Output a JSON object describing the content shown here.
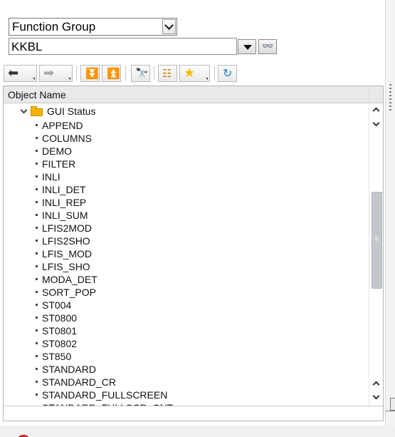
{
  "object_type": {
    "selected": "Function Group"
  },
  "object_name": {
    "value": "KKBL"
  },
  "toolbar": {
    "icons": [
      "back-arrow-icon",
      "forward-arrow-icon",
      "expand-all-icon",
      "collapse-all-icon",
      "binoculars-icon",
      "hierarchy-icon",
      "favorites-star-icon",
      "refresh-icon"
    ]
  },
  "tree": {
    "column_header": "Object Name",
    "folder": {
      "label": "GUI Status",
      "expanded": true
    },
    "items": [
      "APPEND",
      "COLUMNS",
      "DEMO",
      "FILTER",
      "INLI",
      "INLI_DET",
      "INLI_REP",
      "INLI_SUM",
      "LFIS2MOD",
      "LFIS2SHO",
      "LFIS_MOD",
      "LFIS_SHO",
      "MODA_DET",
      "SORT_POP",
      "ST004",
      "ST0800",
      "ST0801",
      "ST0802",
      "ST850",
      "STANDARD",
      "STANDARD_CR",
      "STANDARD_FULLSCREEN",
      "STANDARD_FULLSCR_CNT"
    ]
  },
  "colors": {
    "folder": "#f2b400",
    "star": "#f5b800",
    "refresh": "#2b7fd4",
    "scroll_thumb": "#c3c7cc"
  }
}
